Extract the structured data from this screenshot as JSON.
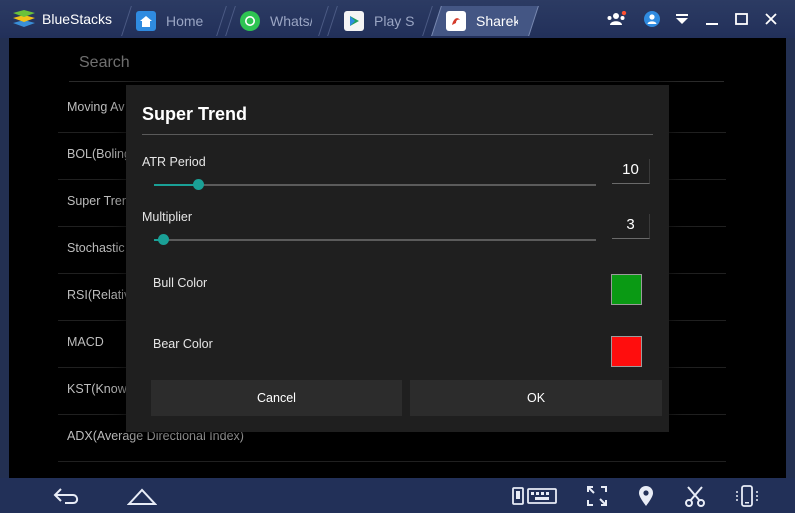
{
  "app": {
    "name": "BlueStacks"
  },
  "tabs": [
    {
      "label": "Home",
      "icon": "home-icon"
    },
    {
      "label": "Whats/",
      "icon": "whatsapp-icon"
    },
    {
      "label": "Play St",
      "icon": "play-store-icon"
    },
    {
      "label": "Sharek",
      "icon": "sharekhan-icon",
      "active": true
    }
  ],
  "window_controls": [
    "people-icon",
    "account-icon",
    "menu-dropdown-icon",
    "minimize-icon",
    "maximize-icon",
    "close-icon"
  ],
  "search": {
    "placeholder": "Search"
  },
  "indicators": [
    "Moving Av",
    "BOL(Boling",
    "Super Tren",
    "Stochastic",
    "RSI(Relativ",
    "MACD",
    "KST(Know",
    "ADX(Average Directional Index)"
  ],
  "dialog": {
    "title": "Super Trend",
    "atr": {
      "label": "ATR Period",
      "value": "10",
      "slider_fraction": 0.1
    },
    "multiplier": {
      "label": "Multiplier",
      "value": "3",
      "slider_fraction": 0.02
    },
    "bull": {
      "label": "Bull Color",
      "color": "#0a9a14"
    },
    "bear": {
      "label": "Bear Color",
      "color": "#ff0d0d"
    },
    "cancel_label": "Cancel",
    "ok_label": "OK"
  },
  "colors": {
    "accent": "#1aa096",
    "chrome": "#223058"
  },
  "navbar": [
    "back-icon",
    "home-icon",
    "keyboard-icon",
    "fullscreen-icon",
    "location-icon",
    "scissors-icon",
    "phone-rotate-icon"
  ]
}
